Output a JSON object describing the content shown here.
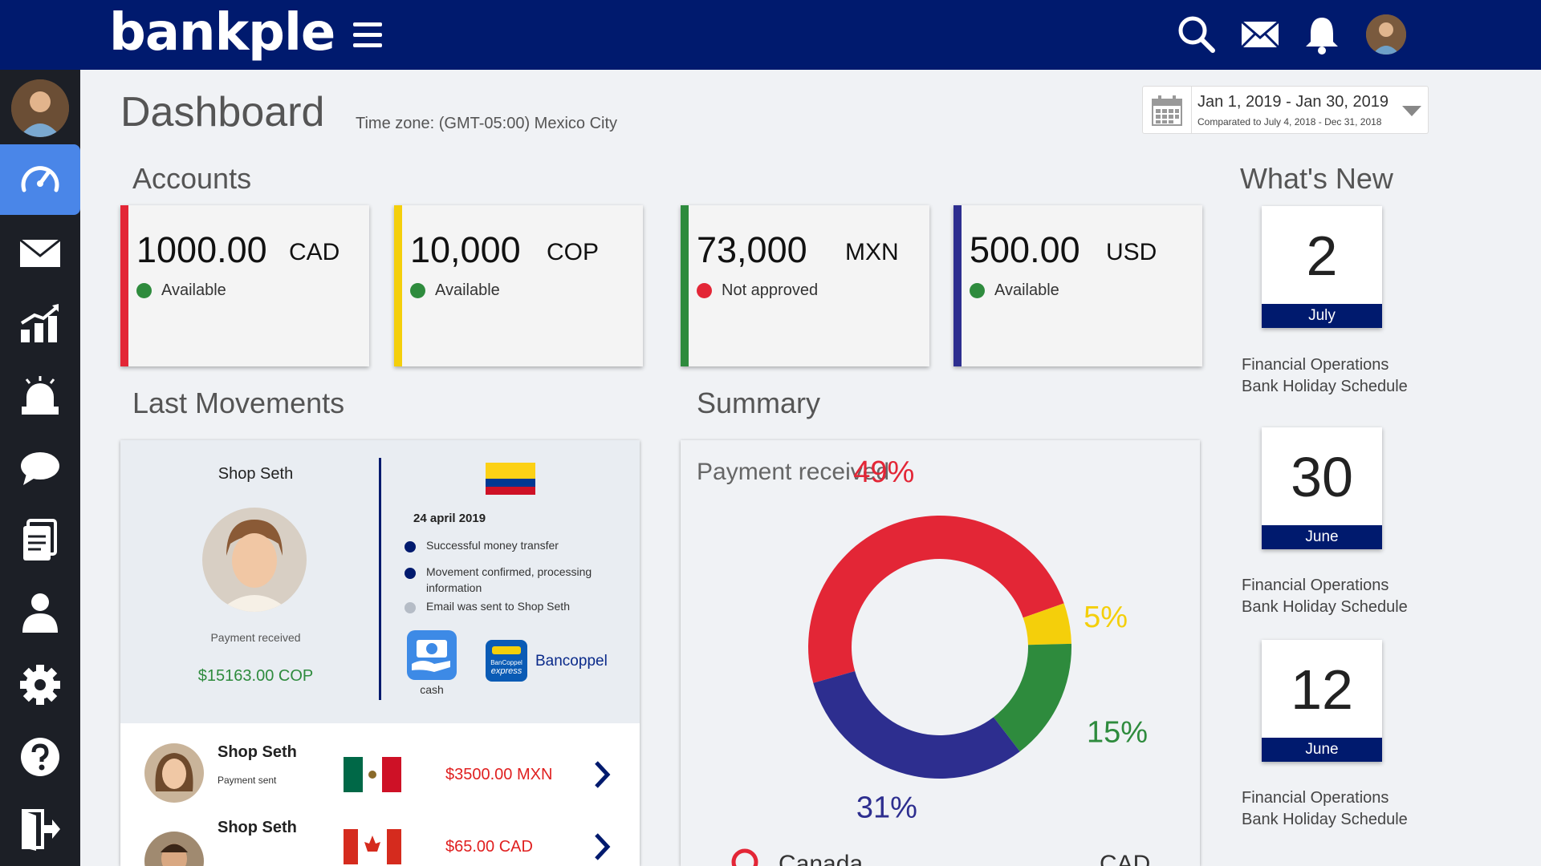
{
  "app": {
    "logo": "bankple"
  },
  "header": {
    "title": "Dashboard",
    "timezone": "Time zone: (GMT-05:00) Mexico City"
  },
  "date_range": {
    "main": "Jan 1, 2019 - Jan 30, 2019",
    "compare": "Comparated to July 4, 2018 - Dec 31, 2018"
  },
  "sections": {
    "accounts": "Accounts",
    "movements": "Last Movements",
    "summary": "Summary",
    "whats_new": "What's New"
  },
  "accounts": [
    {
      "amount": "1000.00",
      "currency": "CAD",
      "status": "Available",
      "color": "#e32636",
      "status_color": "#2e8b3d"
    },
    {
      "amount": "10,000",
      "currency": "COP",
      "status": "Available",
      "color": "#f4cf0b",
      "status_color": "#2e8b3d"
    },
    {
      "amount": "73,000",
      "currency": "MXN",
      "status": "Not approved",
      "color": "#2e8b3d",
      "status_color": "#e32636"
    },
    {
      "amount": "500.00",
      "currency": "USD",
      "status": "Available",
      "color": "#2d2e8f",
      "status_color": "#2e8b3d"
    }
  ],
  "movement_detail": {
    "name": "Shop Seth",
    "label": "Payment received",
    "amount": "$15163.00 COP",
    "date": "24 april 2019",
    "steps": [
      {
        "text": "Successful money transfer",
        "done": true
      },
      {
        "text": "Movement confirmed, processing",
        "text2": "information",
        "done": true
      },
      {
        "text": "Email was sent to Shop Seth",
        "done": false
      }
    ],
    "cash_label": "cash",
    "bank_label": "Bancoppel",
    "bank_logo_text1": "BanCoppel",
    "bank_logo_text2": "express"
  },
  "movements": [
    {
      "name": "Shop Seth",
      "sub": "Payment sent",
      "amount": "$3500.00 MXN",
      "flag": "mexico"
    },
    {
      "name": "Shop Seth",
      "sub": "",
      "amount": "$65.00 CAD",
      "flag": "canada"
    }
  ],
  "summary": {
    "card_title": "Payment received",
    "legend_first": "Canada",
    "legend_first_cur": "CAD"
  },
  "chart_data": {
    "type": "pie",
    "title": "Payment received",
    "categories": [
      "Red",
      "Yellow",
      "Green",
      "Blue"
    ],
    "values": [
      49,
      5,
      15,
      31
    ],
    "labels": [
      "49%",
      "5%",
      "15%",
      "31%"
    ],
    "colors": [
      "#e32636",
      "#f4cf0b",
      "#2e8b3d",
      "#2d2e8f"
    ]
  },
  "whats_new": [
    {
      "day": "2",
      "month": "July",
      "line1": "Financial Operations",
      "line2": "Bank Holiday Schedule"
    },
    {
      "day": "30",
      "month": "June",
      "line1": "Financial Operations",
      "line2": "Bank Holiday Schedule"
    },
    {
      "day": "12",
      "month": "June",
      "line1": "Financial Operations",
      "line2": "Bank Holiday Schedule"
    }
  ]
}
